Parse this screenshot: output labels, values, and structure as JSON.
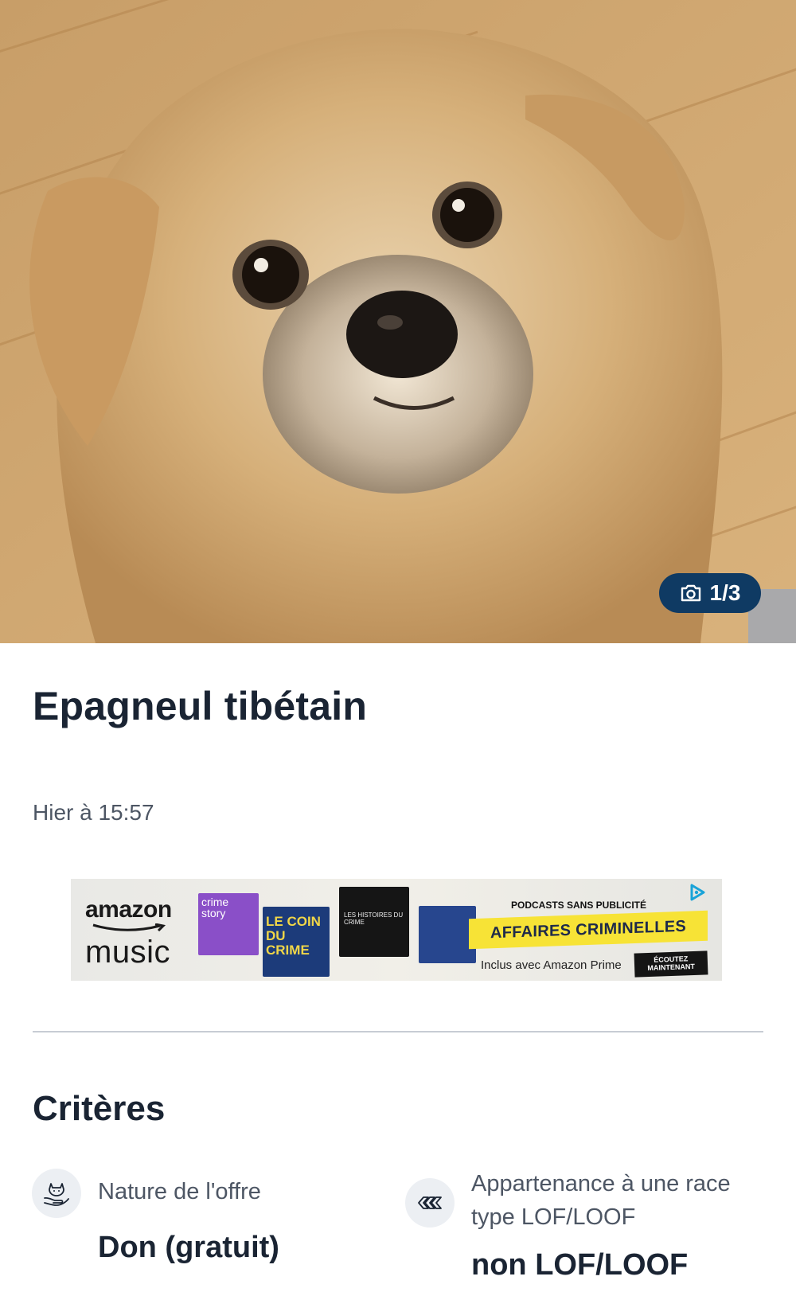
{
  "photo": {
    "alt_icon": "dog-photo",
    "counter": "1/3",
    "counter_icon": "camera-icon"
  },
  "listing": {
    "title": "Epagneul tibétain",
    "posted": "Hier à 15:57"
  },
  "ad": {
    "brand_line1": "amazon",
    "brand_line2": "music",
    "cover1": "crime story",
    "cover2": "LE COIN DU CRIME",
    "cover3": "LES HISTOIRES DU CRIME",
    "tagline": "PODCASTS SANS PUBLICITÉ",
    "headline": "AFFAIRES CRIMINELLES",
    "subline": "Inclus avec Amazon Prime",
    "cta": "ÉCOUTEZ MAINTENANT",
    "badge_icon": "adchoices-icon"
  },
  "criteria": {
    "section_title": "Critères",
    "items": [
      {
        "icon": "cat-hand-icon",
        "label": "Nature de l'offre",
        "value": "Don (gratuit)"
      },
      {
        "icon": "pedigree-arrows-icon",
        "label": "Appartenance à une race type LOF/LOOF",
        "value": "non LOF/LOOF"
      }
    ]
  },
  "colors": {
    "accent": "#0f3a63",
    "text": "#1a2433",
    "muted": "#4d5664",
    "divider": "#c7ccd4"
  }
}
